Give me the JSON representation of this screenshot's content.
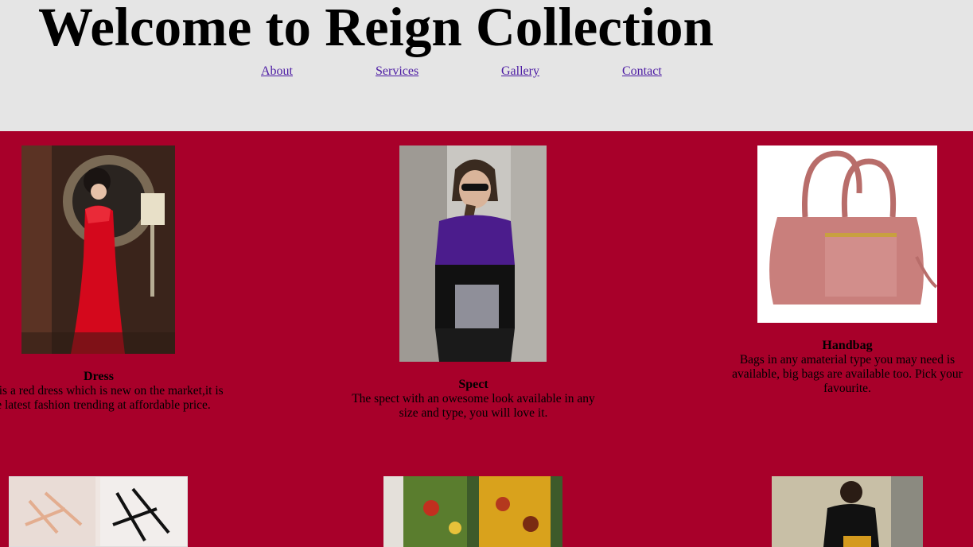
{
  "header": {
    "title": "Welcome to Reign Collection",
    "nav": [
      "About",
      "Services",
      "Gallery",
      "Contact"
    ]
  },
  "products": [
    {
      "name": "Dress",
      "description": "This is a red dress which is new on the market,it is the latest fashion trending at affordable price."
    },
    {
      "name": "Spect",
      "description": "The spect with an owesome look available in any size and type, you will love it."
    },
    {
      "name": "Handbag",
      "description": "Bags in any amaterial type you may need is available, big bags are available too. Pick your favourite."
    }
  ],
  "colors": {
    "page_background": "#a8002a",
    "header_background": "#e5e5e5",
    "link": "#4b1aa3"
  }
}
